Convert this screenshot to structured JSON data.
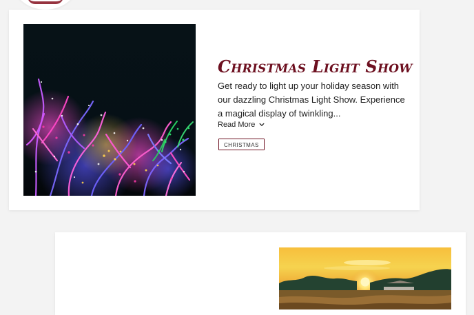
{
  "cards": [
    {
      "title": "Christmas Light Show",
      "description": "Get ready to light up your holiday season with our dazzling Christmas Light Show. Experience a magical display of twinkling...",
      "read_more_label": "Read More",
      "tag": "CHRISTMAS",
      "image_alt": "christmas-lights-trees",
      "icon": "chevron-down-icon"
    },
    {
      "title": "",
      "image_alt": "sunset-field"
    }
  ]
}
